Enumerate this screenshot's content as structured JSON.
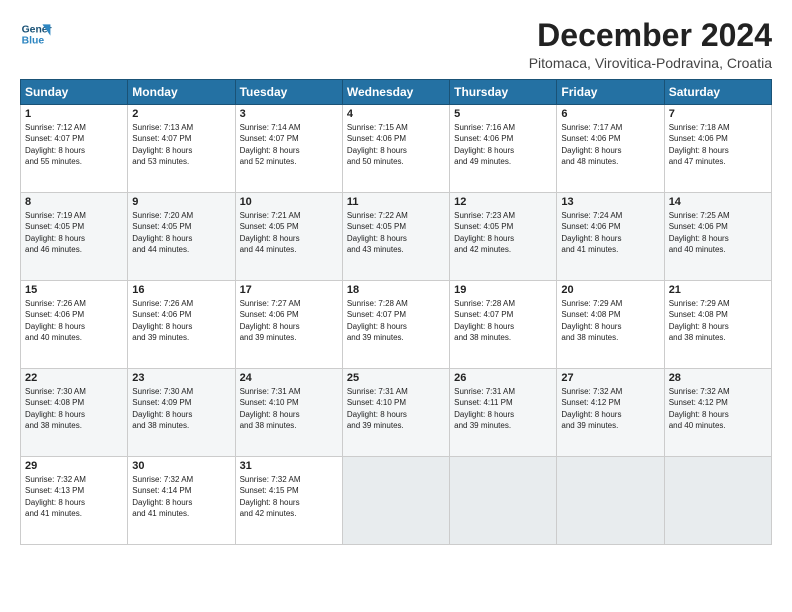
{
  "header": {
    "logo_line1": "General",
    "logo_line2": "Blue",
    "month": "December 2024",
    "location": "Pitomaca, Virovitica-Podravina, Croatia"
  },
  "weekdays": [
    "Sunday",
    "Monday",
    "Tuesday",
    "Wednesday",
    "Thursday",
    "Friday",
    "Saturday"
  ],
  "weeks": [
    [
      {
        "day": "1",
        "info": "Sunrise: 7:12 AM\nSunset: 4:07 PM\nDaylight: 8 hours\nand 55 minutes."
      },
      {
        "day": "2",
        "info": "Sunrise: 7:13 AM\nSunset: 4:07 PM\nDaylight: 8 hours\nand 53 minutes."
      },
      {
        "day": "3",
        "info": "Sunrise: 7:14 AM\nSunset: 4:07 PM\nDaylight: 8 hours\nand 52 minutes."
      },
      {
        "day": "4",
        "info": "Sunrise: 7:15 AM\nSunset: 4:06 PM\nDaylight: 8 hours\nand 50 minutes."
      },
      {
        "day": "5",
        "info": "Sunrise: 7:16 AM\nSunset: 4:06 PM\nDaylight: 8 hours\nand 49 minutes."
      },
      {
        "day": "6",
        "info": "Sunrise: 7:17 AM\nSunset: 4:06 PM\nDaylight: 8 hours\nand 48 minutes."
      },
      {
        "day": "7",
        "info": "Sunrise: 7:18 AM\nSunset: 4:06 PM\nDaylight: 8 hours\nand 47 minutes."
      }
    ],
    [
      {
        "day": "8",
        "info": "Sunrise: 7:19 AM\nSunset: 4:05 PM\nDaylight: 8 hours\nand 46 minutes."
      },
      {
        "day": "9",
        "info": "Sunrise: 7:20 AM\nSunset: 4:05 PM\nDaylight: 8 hours\nand 44 minutes."
      },
      {
        "day": "10",
        "info": "Sunrise: 7:21 AM\nSunset: 4:05 PM\nDaylight: 8 hours\nand 44 minutes."
      },
      {
        "day": "11",
        "info": "Sunrise: 7:22 AM\nSunset: 4:05 PM\nDaylight: 8 hours\nand 43 minutes."
      },
      {
        "day": "12",
        "info": "Sunrise: 7:23 AM\nSunset: 4:05 PM\nDaylight: 8 hours\nand 42 minutes."
      },
      {
        "day": "13",
        "info": "Sunrise: 7:24 AM\nSunset: 4:06 PM\nDaylight: 8 hours\nand 41 minutes."
      },
      {
        "day": "14",
        "info": "Sunrise: 7:25 AM\nSunset: 4:06 PM\nDaylight: 8 hours\nand 40 minutes."
      }
    ],
    [
      {
        "day": "15",
        "info": "Sunrise: 7:26 AM\nSunset: 4:06 PM\nDaylight: 8 hours\nand 40 minutes."
      },
      {
        "day": "16",
        "info": "Sunrise: 7:26 AM\nSunset: 4:06 PM\nDaylight: 8 hours\nand 39 minutes."
      },
      {
        "day": "17",
        "info": "Sunrise: 7:27 AM\nSunset: 4:06 PM\nDaylight: 8 hours\nand 39 minutes."
      },
      {
        "day": "18",
        "info": "Sunrise: 7:28 AM\nSunset: 4:07 PM\nDaylight: 8 hours\nand 39 minutes."
      },
      {
        "day": "19",
        "info": "Sunrise: 7:28 AM\nSunset: 4:07 PM\nDaylight: 8 hours\nand 38 minutes."
      },
      {
        "day": "20",
        "info": "Sunrise: 7:29 AM\nSunset: 4:08 PM\nDaylight: 8 hours\nand 38 minutes."
      },
      {
        "day": "21",
        "info": "Sunrise: 7:29 AM\nSunset: 4:08 PM\nDaylight: 8 hours\nand 38 minutes."
      }
    ],
    [
      {
        "day": "22",
        "info": "Sunrise: 7:30 AM\nSunset: 4:08 PM\nDaylight: 8 hours\nand 38 minutes."
      },
      {
        "day": "23",
        "info": "Sunrise: 7:30 AM\nSunset: 4:09 PM\nDaylight: 8 hours\nand 38 minutes."
      },
      {
        "day": "24",
        "info": "Sunrise: 7:31 AM\nSunset: 4:10 PM\nDaylight: 8 hours\nand 38 minutes."
      },
      {
        "day": "25",
        "info": "Sunrise: 7:31 AM\nSunset: 4:10 PM\nDaylight: 8 hours\nand 39 minutes."
      },
      {
        "day": "26",
        "info": "Sunrise: 7:31 AM\nSunset: 4:11 PM\nDaylight: 8 hours\nand 39 minutes."
      },
      {
        "day": "27",
        "info": "Sunrise: 7:32 AM\nSunset: 4:12 PM\nDaylight: 8 hours\nand 39 minutes."
      },
      {
        "day": "28",
        "info": "Sunrise: 7:32 AM\nSunset: 4:12 PM\nDaylight: 8 hours\nand 40 minutes."
      }
    ],
    [
      {
        "day": "29",
        "info": "Sunrise: 7:32 AM\nSunset: 4:13 PM\nDaylight: 8 hours\nand 41 minutes."
      },
      {
        "day": "30",
        "info": "Sunrise: 7:32 AM\nSunset: 4:14 PM\nDaylight: 8 hours\nand 41 minutes."
      },
      {
        "day": "31",
        "info": "Sunrise: 7:32 AM\nSunset: 4:15 PM\nDaylight: 8 hours\nand 42 minutes."
      },
      {
        "day": "",
        "info": ""
      },
      {
        "day": "",
        "info": ""
      },
      {
        "day": "",
        "info": ""
      },
      {
        "day": "",
        "info": ""
      }
    ]
  ]
}
